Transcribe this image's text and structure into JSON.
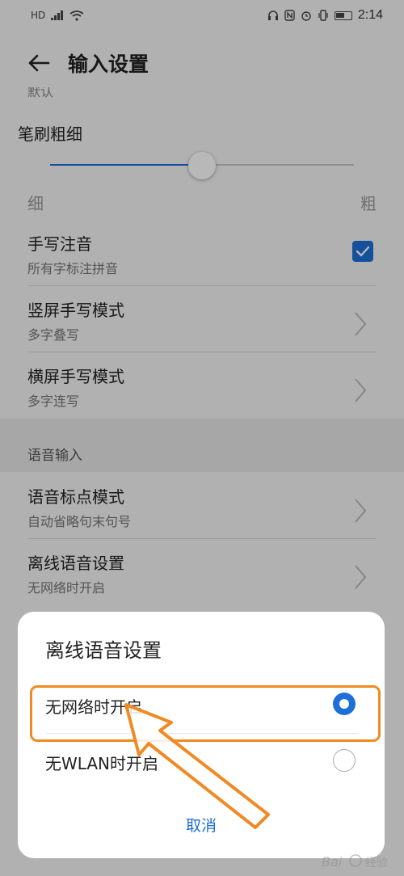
{
  "status_bar": {
    "left_icons": [
      "HD",
      "signal-icon",
      "wifi-icon"
    ],
    "hd_label": "HD",
    "right_icons": [
      "headphone-icon",
      "nfc-icon",
      "alarm-icon",
      "vibrate-icon",
      "battery-icon"
    ],
    "time": "2:14"
  },
  "header": {
    "title": "输入设置",
    "back_icon": "arrow-left-icon"
  },
  "cutoff_text": "默认",
  "brush": {
    "label": "笔刷粗细",
    "value_fraction": 0.5,
    "min_label": "细",
    "max_label": "粗"
  },
  "handwriting_items": [
    {
      "title": "手写注音",
      "subtitle": "所有字标注拼音",
      "control": "checkbox",
      "checked": true
    },
    {
      "title": "竖屏手写模式",
      "subtitle": "多字叠写",
      "control": "chevron"
    },
    {
      "title": "横屏手写模式",
      "subtitle": "多字连写",
      "control": "chevron"
    }
  ],
  "voice_section": {
    "title": "语音输入",
    "items": [
      {
        "title": "语音标点模式",
        "subtitle": "自动省略句末句号",
        "control": "chevron"
      },
      {
        "title": "离线语音设置",
        "subtitle": "无网络时开启",
        "control": "chevron"
      }
    ]
  },
  "dialog": {
    "title": "离线语音设置",
    "options": [
      {
        "label": "无网络时开启",
        "selected": true
      },
      {
        "label": "无WLAN时开启",
        "selected": false
      }
    ],
    "cancel_label": "取消"
  },
  "colors": {
    "accent": "#1e6fd9",
    "highlight": "#f08a24",
    "background": "#f5f5f5"
  },
  "watermark": "Baidu 经验"
}
